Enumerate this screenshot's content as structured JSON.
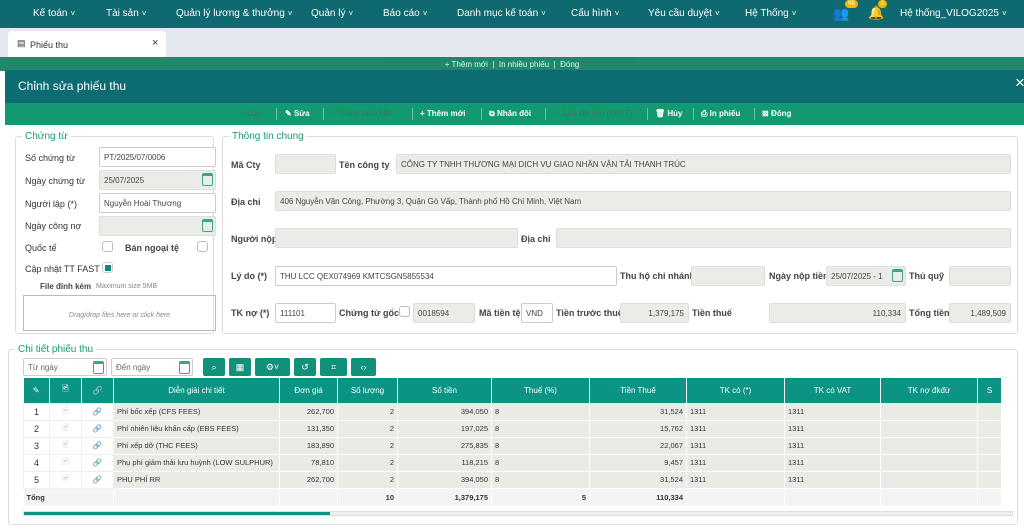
{
  "nav": {
    "items": [
      "Kế toán",
      "Tài sản",
      "Quản lý lương & thưởng",
      "Quản lý",
      "Báo cáo",
      "Danh mục kế toán",
      "Cấu hình",
      "Yêu cầu duyệt",
      "Hệ Thống"
    ],
    "user": "Hệ thống_VILOG2025",
    "group_badge": "96",
    "bell_badge": "0"
  },
  "tab": {
    "label": "Phiếu thu",
    "close": "×"
  },
  "bg_toolbar": {
    "add": "+ Thêm mới",
    "print_many": "In nhiều phiếu",
    "close": "Đóng"
  },
  "modal": {
    "title": "Chỉnh sửa phiếu thu",
    "close": "×"
  },
  "toolbar": {
    "save": "Lưu",
    "edit": "Sửa",
    "pay_invoice": "Thanh toán HĐ",
    "add": "+ Thêm mới",
    "duplicate": "Nhân đôi",
    "link_fast": "Link dữ liệu (FAST)",
    "cancel": "Hủy",
    "print": "In phiếu",
    "close": "Đóng"
  },
  "voucher": {
    "legend": "Chứng từ",
    "so_chung_tu_label": "Số chứng từ",
    "so_chung_tu": "PT/2025/07/0006",
    "ngay_chung_tu_label": "Ngày chứng từ",
    "ngay_chung_tu": "25/07/2025",
    "nguoi_lap_label": "Người lập (*)",
    "nguoi_lap": "Nguyễn Hoài Thương",
    "ngay_cong_no_label": "Ngày công nợ",
    "ngay_cong_no": "",
    "quoc_te_label": "Quốc tế",
    "ban_ngoai_te_label": "Bán ngoại tệ",
    "cap_nhat_label": "Cập nhật TT FAST",
    "file_label": "File đính kèm",
    "file_hint": "Maximum size 5MB",
    "drop_text": "Drag/drop files here or click here"
  },
  "general": {
    "legend": "Thông tin chung",
    "ma_cty_label": "Mã Cty",
    "ma_cty": "",
    "ten_cty_label": "Tên công ty",
    "ten_cty": "CÔNG TY TNHH THƯƠNG MẠI DỊCH VỤ GIAO NHẬN VẬN TẢI THANH TRÚC",
    "dia_chi_label": "Địa chỉ",
    "dia_chi": "406 Nguyễn Văn Công, Phường 3, Quận Gò Vấp, Thành phố Hồ Chí Minh, Việt Nam",
    "nguoi_nop_label": "Người nộp",
    "nguoi_nop": "",
    "dia_chi2_label": "Địa chỉ",
    "dia_chi2": "",
    "ly_do_label": "Lý do (*)",
    "ly_do": "THU LCC QEX074969 KMTCSGN5855534",
    "thu_ho_label": "Thu hộ chi nhánh",
    "thu_ho": "",
    "ngay_nop_label": "Ngày nộp tiền",
    "ngay_nop": "25/07/2025 - 1",
    "thu_quy_label": "Thủ quỹ",
    "thu_quy": "",
    "tk_no_label": "TK nợ (*)",
    "tk_no": "111101",
    "ct_goc_label": "Chứng từ gốc",
    "ct_goc": "0018594",
    "ma_tien_te_label": "Mã tiền tệ",
    "ma_tien_te": "VND",
    "tien_truoc_thue_label": "Tiền trước thuế",
    "tien_truoc_thue": "1,379,175",
    "tien_thue_label": "Tiền thuế",
    "tien_thue": "110,334",
    "tong_tien_label": "Tổng tiền",
    "tong_tien": "1,489,509"
  },
  "details": {
    "legend": "Chi tiết phiếu thu",
    "from_placeholder": "Từ ngày",
    "to_placeholder": "Đến ngày",
    "columns": [
      "",
      "",
      "",
      "Diễn giải chi tiết",
      "Đơn giá",
      "Số lượng",
      "Số tiền",
      "Thuế (%)",
      "Tiền Thuế",
      "TK có (*)",
      "TK có VAT",
      "TK nợ đkđừ",
      "S"
    ],
    "rows": [
      [
        "1",
        "Phí bốc xếp (CFS FEES)",
        "262,700",
        "2",
        "394,050",
        "8",
        "31,524",
        "1311",
        "1311"
      ],
      [
        "2",
        "Phí nhiên liệu khẩn cấp (EBS FEES)",
        "131,350",
        "2",
        "197,025",
        "8",
        "15,762",
        "1311",
        "1311"
      ],
      [
        "3",
        "Phí xếp dỡ (THC FEES)",
        "183,890",
        "2",
        "275,835",
        "8",
        "22,067",
        "1311",
        "1311"
      ],
      [
        "4",
        "Phụ phí giảm thải lưu huỳnh (LOW SULPHUR)",
        "78,810",
        "2",
        "118,215",
        "8",
        "9,457",
        "1311",
        "1311"
      ],
      [
        "5",
        "PHỤ PHÍ RR",
        "262,700",
        "2",
        "394,050",
        "8",
        "31,524",
        "1311",
        "1311"
      ]
    ],
    "total": {
      "label": "Tổng",
      "qty": "10",
      "amount": "1,379,175",
      "tax_pct": "5",
      "tax": "110,334"
    },
    "scroll_progress": 0.31
  },
  "colors": {
    "nav": "#0e6a70",
    "toolbar": "#13996f",
    "table_header": "#0b9483"
  }
}
